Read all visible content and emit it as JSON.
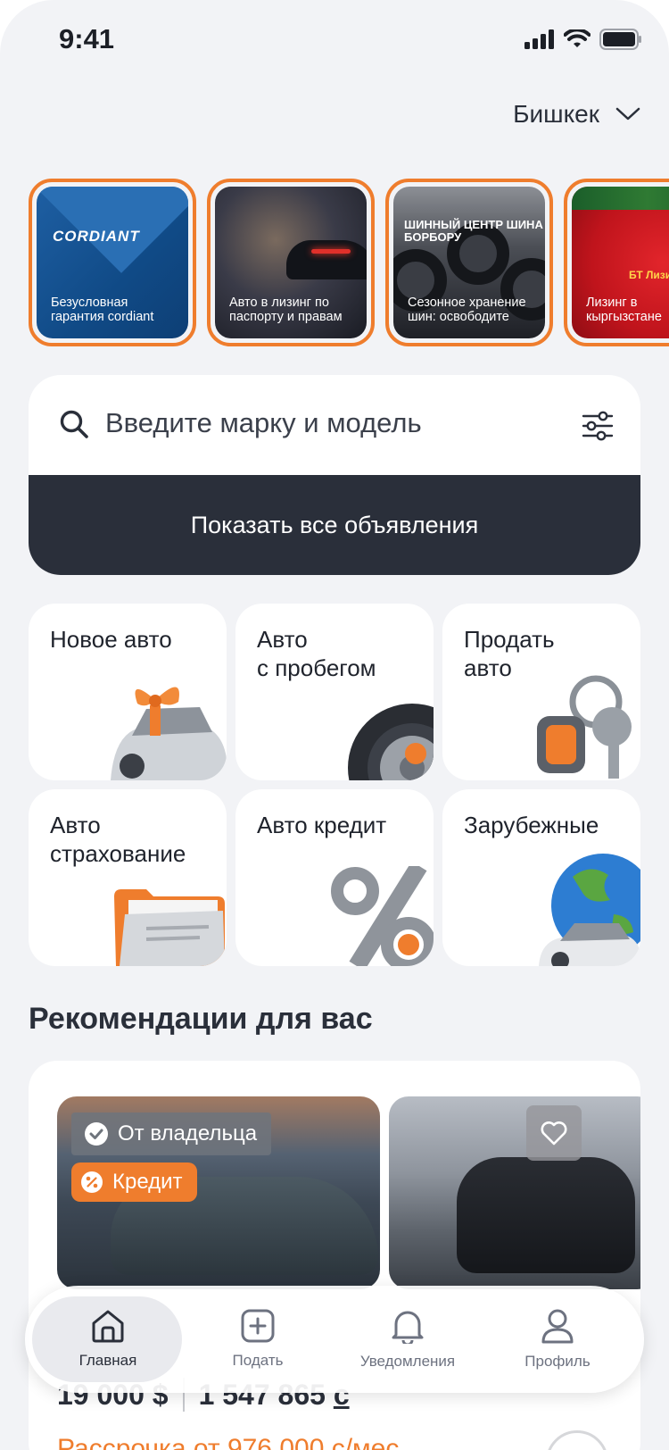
{
  "status_bar": {
    "time": "9:41"
  },
  "header": {
    "city": "Бишкек"
  },
  "stories": [
    {
      "logo": "CORDIANT",
      "text": "Безусловная гарантия cordiant"
    },
    {
      "text": "Авто в лизинг по паспорту и правам"
    },
    {
      "logo": "ШИННЫЙ ЦЕНТР ШИНА БОРБОРУ",
      "text": "Сезонное хранение шин: освободите"
    },
    {
      "logo": "БТ Лизинг",
      "text": "Лизинг в кыргызстане"
    }
  ],
  "search": {
    "placeholder": "Введите марку и модель",
    "show_all_label": "Показать все объявления"
  },
  "categories": [
    {
      "label": "Новое авто",
      "icon": "gift-car-icon"
    },
    {
      "label": "Авто\nс пробегом",
      "icon": "wheel-icon"
    },
    {
      "label": "Продать\nавто",
      "icon": "car-keys-icon"
    },
    {
      "label": "Авто\nстрахование",
      "icon": "folder-icon"
    },
    {
      "label": "Авто кредит",
      "icon": "percent-icon"
    },
    {
      "label": "Зарубежные",
      "icon": "globe-car-icon"
    }
  ],
  "recommendations": {
    "title": "Рекомендации для вас",
    "listings": [
      {
        "badge_owner": "От владельца",
        "badge_credit": "Кредит",
        "price_usd": "19 000 $",
        "price_som": "1 547 865",
        "price_som_currency": "с",
        "monthly": "Рассрочка от 976 000 с/мес"
      },
      {
        "favorite": false
      }
    ]
  },
  "bottom_nav": [
    {
      "label": "Главная",
      "icon": "home-icon",
      "active": true
    },
    {
      "label": "Подать",
      "icon": "add-square-icon",
      "active": false
    },
    {
      "label": "Уведомления",
      "icon": "bell-icon",
      "active": false
    },
    {
      "label": "Профиль",
      "icon": "user-icon",
      "active": false
    }
  ],
  "colors": {
    "accent": "#ef7d2d",
    "dark": "#2a2f3a",
    "background": "#f2f3f6"
  }
}
